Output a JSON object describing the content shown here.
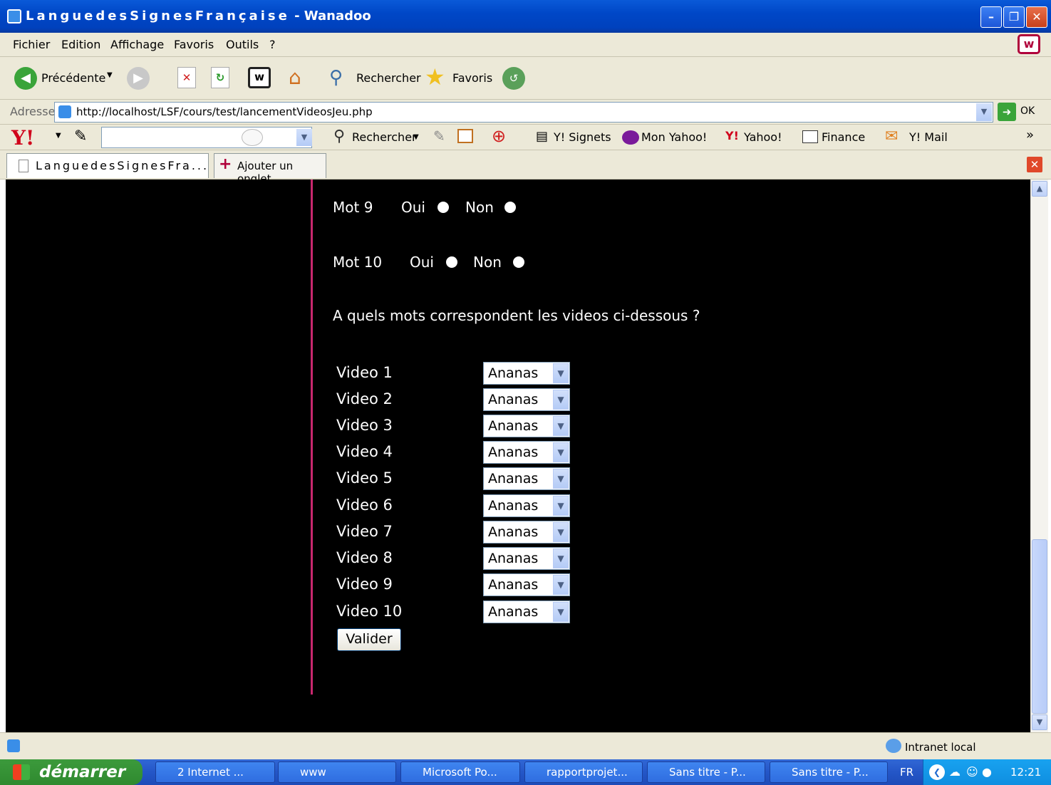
{
  "window": {
    "title_spaced": "LanguedesSignesFrançaise",
    "title_suffix": " - Wanadoo"
  },
  "menu": [
    "Fichier",
    "Edition",
    "Affichage",
    "Favoris",
    "Outils",
    "?"
  ],
  "toolbar": {
    "back_label": "Précédente",
    "search_label": "Rechercher",
    "favorites_label": "Favoris"
  },
  "address": {
    "label": "Adresse",
    "url": "http://localhost/LSF/cours/test/lancementVideosJeu.php",
    "go_label": "OK"
  },
  "yahoo": {
    "search_label": "Rechercher",
    "signets": "Y! Signets",
    "mon_yahoo": "Mon Yahoo!",
    "yahoo": "Yahoo!",
    "finance": "Finance",
    "mail": "Y! Mail",
    "more": "»"
  },
  "tabs": {
    "active_tab": "LanguedesSignesFra...",
    "add_tab": "Ajouter un onglet"
  },
  "page": {
    "mots": [
      {
        "label": "Mot 9",
        "oui": "Oui",
        "non": "Non"
      },
      {
        "label": "Mot 10",
        "oui": "Oui",
        "non": "Non"
      }
    ],
    "question": "A quels mots correspondent les videos ci-dessous ?",
    "videos": [
      {
        "label": "Video 1",
        "value": "Ananas"
      },
      {
        "label": "Video 2",
        "value": "Ananas"
      },
      {
        "label": "Video 3",
        "value": "Ananas"
      },
      {
        "label": "Video 4",
        "value": "Ananas"
      },
      {
        "label": "Video 5",
        "value": "Ananas"
      },
      {
        "label": "Video 6",
        "value": "Ananas"
      },
      {
        "label": "Video 7",
        "value": "Ananas"
      },
      {
        "label": "Video 8",
        "value": "Ananas"
      },
      {
        "label": "Video 9",
        "value": "Ananas"
      },
      {
        "label": "Video 10",
        "value": "Ananas"
      }
    ],
    "submit": "Valider"
  },
  "status": {
    "zone": "Intranet local"
  },
  "taskbar": {
    "start": "démarrer",
    "tasks": [
      "2 Internet ...",
      "www",
      "Microsoft Po...",
      "rapportprojet...",
      "Sans titre - P...",
      "Sans titre - P..."
    ],
    "lang": "FR",
    "clock": "12:21"
  },
  "colors": {
    "accent_line": "#c8286e",
    "page_bg": "#000000",
    "titlebar_blue": "#0047c7"
  }
}
